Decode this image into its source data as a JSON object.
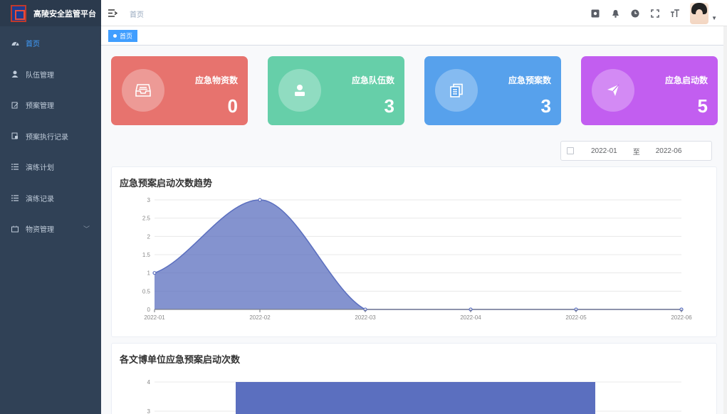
{
  "app": {
    "title": "高陵安全监管平台"
  },
  "sidebar": {
    "items": [
      {
        "label": "首页",
        "icon": "dashboard-icon",
        "active": true
      },
      {
        "label": "队伍管理",
        "icon": "user-icon"
      },
      {
        "label": "预案管理",
        "icon": "edit-icon"
      },
      {
        "label": "预案执行记录",
        "icon": "record-icon"
      },
      {
        "label": "演练计划",
        "icon": "list-icon"
      },
      {
        "label": "演练记录",
        "icon": "list-icon"
      },
      {
        "label": "物资管理",
        "icon": "box-icon",
        "has_children": true
      }
    ]
  },
  "navbar": {
    "breadcrumb": "首页",
    "icons": [
      "screenshot-icon",
      "bell-icon",
      "clock-icon",
      "fullscreen-icon",
      "font-size-icon"
    ]
  },
  "tags": {
    "active": "首页"
  },
  "cards": [
    {
      "label": "应急物资数",
      "value": "0",
      "color": "#e7736e",
      "icon": "inbox-icon"
    },
    {
      "label": "应急队伍数",
      "value": "3",
      "color": "#66cfa9",
      "icon": "person-icon"
    },
    {
      "label": "应急预案数",
      "value": "3",
      "color": "#57a1ec",
      "icon": "document-icon"
    },
    {
      "label": "应急启动数",
      "value": "5",
      "color": "#c25ef0",
      "icon": "send-icon"
    }
  ],
  "date_range": {
    "start": "2022-01",
    "separator": "至",
    "end": "2022-06"
  },
  "chart_data": [
    {
      "type": "area",
      "title": "应急预案启动次数趋势",
      "x": [
        "2022-01",
        "2022-02",
        "2022-03",
        "2022-04",
        "2022-05",
        "2022-06"
      ],
      "values": [
        1,
        3,
        0,
        0,
        0,
        0
      ],
      "ylim": [
        0,
        3
      ],
      "yticks": [
        "0",
        "0.5",
        "1",
        "1.5",
        "2",
        "2.5",
        "3"
      ],
      "color": "#5b6fbf",
      "grid": true
    },
    {
      "type": "bar",
      "title": "各文博单位应急预案启动次数",
      "values": [
        4
      ],
      "yticks_visible": [
        "4",
        "3"
      ],
      "color": "#5b6fbf"
    }
  ]
}
